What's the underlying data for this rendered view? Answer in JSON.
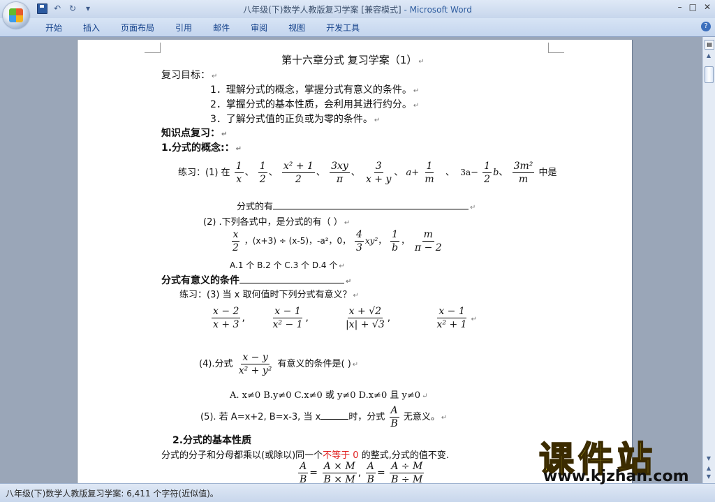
{
  "window": {
    "title": "八年级(下)数学人教版复习学案 [兼容模式]",
    "app": " - Microsoft Word",
    "controls": [
      "–",
      "□",
      "✕"
    ]
  },
  "ribbon": {
    "tabs": [
      "开始",
      "插入",
      "页面布局",
      "引用",
      "邮件",
      "审阅",
      "视图",
      "开发工具"
    ]
  },
  "status": {
    "text": "八年级(下)数学人教版复习学案: 6,411 个字符(近似值)。"
  },
  "doc": {
    "heading": "第十六章分式 复习学案（1）",
    "goals_label": "复习目标：",
    "goal1": "1．理解分式的概念，掌握分式有意义的条件。",
    "goal2": "2．掌握分式的基本性质，会利用其进行约分。",
    "goal3": "3．了解分式值的正负或为零的条件。",
    "review_label": "知识点复习：",
    "concept_label": "1.分式的概念:：",
    "ex1_prefix": "练习：(1)  在",
    "ex1_sep": "、",
    "ex1_a": "a",
    "ex1_plus": "+",
    "ex1_comma": "、",
    "ex1_3a2": "3a",
    "ex1_minus": "−",
    "ex1_b": "b",
    "ex1_suffix": "中是",
    "ex1_answer_label": "分式的有",
    "ex2_prefix": "(2) .下列各式中，是分式的有（      ）",
    "ex2_mid": "，(x+3) ÷ (x-5)，-a²，0，",
    "ex2_xy2": "xy²",
    "ex2_comma": "，",
    "choices1": "A.1 个        B.2 个             C.3 个          D.4 个",
    "meaning_label": "分式有意义的条件",
    "ex3": "练习：(3) 当 x 取何值时下列分式有意义？",
    "ex4_prefix": "(4).分式",
    "ex4_suffix": "有意义的条件是(       )",
    "choices2": "A.   x≠0   B.y≠0   C.x≠0 或 y≠0   D.x≠0 且 y≠0",
    "ex5": "(5). 若 A=x+2, B=x-3, 当 x",
    "ex5_mid": "时，分式",
    "ex5_suffix": "无意义。",
    "property_label": "2.分式的基本性质",
    "property_a": "分式的分子和分母都乘以(或除以)同一个",
    "property_red": "不等于 0",
    "property_b": " 的整式,分式的值不变.",
    "f_1": "1",
    "f_x": "x",
    "f_2": "2",
    "f_x2p1": "x² + 1",
    "f_3xy": "3xy",
    "f_pi": "π",
    "f_3": "3",
    "f_xpy": "x + y",
    "f_m": "m",
    "f_3m2": "3m²",
    "f_xx": "x",
    "f_b": "b",
    "f_mm": "m",
    "f_pim2": "π − 2",
    "f_4": "4",
    "f_33": "3",
    "f_xm2": "x − 2",
    "f_xp3": "x + 3",
    "f_xm1": "x − 1",
    "f_x2m1": "x² − 1",
    "f_xps2": "x + √2",
    "f_absx": "|x| + √3",
    "f_xm1b": "x − 1",
    "f_x2p1b": "x² + 1",
    "f_xmy": "x − y",
    "f_x2py2": "x² + y²",
    "f_A": "A",
    "f_B": "B",
    "f_AxM": "A × M",
    "f_BxM": "B × M",
    "f_AdM": "A ÷ M",
    "f_BdM": "B ÷ M",
    "eq": "=",
    "comma": ","
  },
  "watermark": {
    "title": "课件站",
    "url": "www.kjzhan.com"
  },
  "colors": {
    "accent": "#2e5c9e",
    "red_text": "#e02020",
    "watermark_yellow": "#f1e63a"
  }
}
